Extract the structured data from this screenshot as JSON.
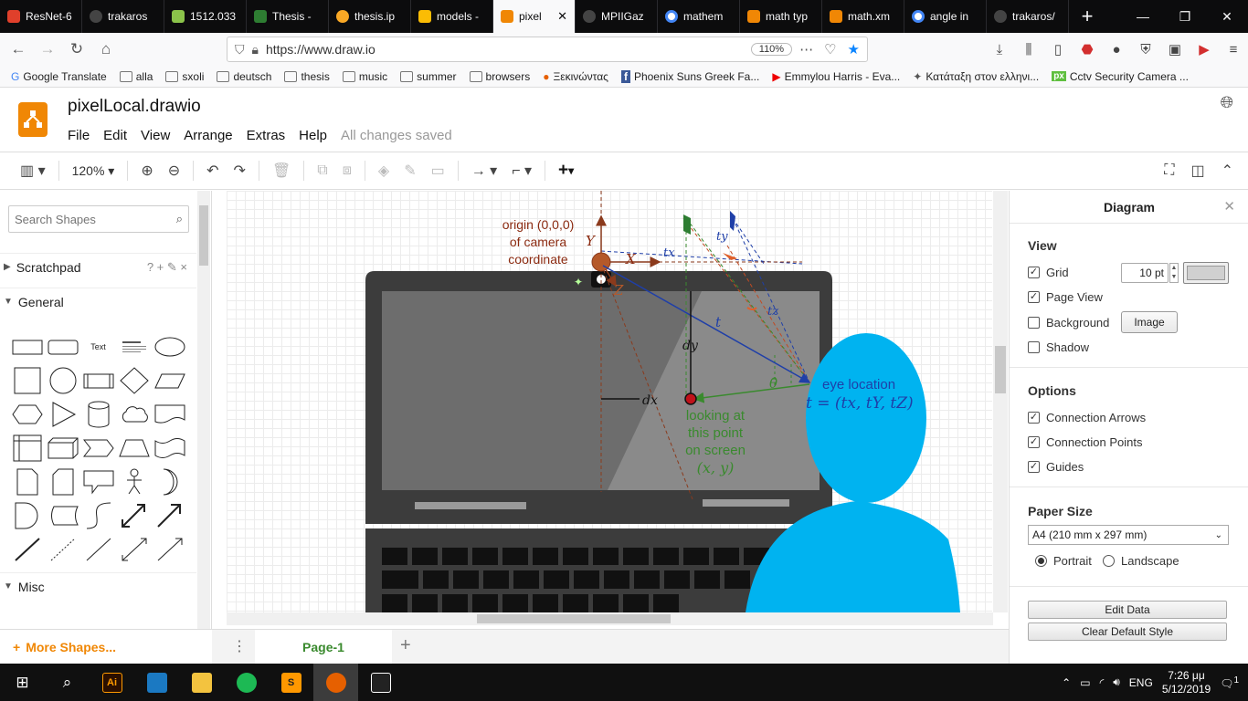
{
  "browser": {
    "tabs": [
      {
        "label": "ResNet-6",
        "color": "#e0402b",
        "active": false
      },
      {
        "label": "trakaros",
        "color": "#24292e",
        "active": false
      },
      {
        "label": "1512.033",
        "color": "#8bc34a",
        "active": false
      },
      {
        "label": "Thesis -",
        "color": "#2e7d32",
        "active": false
      },
      {
        "label": "thesis.ip",
        "color": "#f9a825",
        "active": false
      },
      {
        "label": "models -",
        "color": "#fbbc04",
        "active": false
      },
      {
        "label": "pixel",
        "color": "#f08705",
        "active": true
      },
      {
        "label": "MPIIGaz",
        "color": "#24292e",
        "active": false
      },
      {
        "label": "mathem",
        "color": "#4285f4",
        "active": false
      },
      {
        "label": "math typ",
        "color": "#f08705",
        "active": false
      },
      {
        "label": "math.xm",
        "color": "#f08705",
        "active": false
      },
      {
        "label": "angle in",
        "color": "#4285f4",
        "active": false
      },
      {
        "label": "trakaros/",
        "color": "#24292e",
        "active": false
      }
    ],
    "url": "https://www.draw.io",
    "zoom": "110%",
    "bookmarks": [
      "Google Translate",
      "alla",
      "sxoli",
      "deutsch",
      "thesis",
      "music",
      "summer",
      "browsers",
      "Ξεκινώντας",
      "Phoenix Suns Greek Fa...",
      "Emmylou Harris - Eva...",
      "Κατάταξη στον ελληνι...",
      "Cctv Security Camera ..."
    ]
  },
  "app": {
    "title": "pixelLocal.drawio",
    "menu": [
      "File",
      "Edit",
      "View",
      "Arrange",
      "Extras",
      "Help"
    ],
    "save_status": "All changes saved"
  },
  "toolbar": {
    "zoom": "120%"
  },
  "sidebar": {
    "search_placeholder": "Search Shapes",
    "scratchpad": "Scratchpad",
    "scratch_tools": "? + ✎ ×",
    "general": "General",
    "misc": "Misc",
    "more_shapes": "More Shapes..."
  },
  "diagram": {
    "origin_label_1": "origin (0,0,0)",
    "origin_label_2": "of camera",
    "origin_label_3": "coordinate",
    "axis_y": "Y",
    "axis_x": "X",
    "axis_z": "Z",
    "tx": "tx",
    "ty": "ty",
    "tz": "tz",
    "t": "t",
    "dx": "dx",
    "dy": "dy",
    "theta": "θ̂",
    "eye_label": "eye location",
    "eye_formula": "t = (tx, tY, tZ)",
    "look_1": "looking at",
    "look_2": "this point",
    "look_3": "on screen",
    "look_4": "(x, y)"
  },
  "page": {
    "tab": "Page-1"
  },
  "panel": {
    "title": "Diagram",
    "view_head": "View",
    "grid": "Grid",
    "grid_size": "10 pt",
    "page_view": "Page View",
    "background": "Background",
    "image_btn": "Image",
    "shadow": "Shadow",
    "options_head": "Options",
    "connection_arrows": "Connection Arrows",
    "connection_points": "Connection Points",
    "guides": "Guides",
    "paper_head": "Paper Size",
    "paper_value": "A4 (210 mm x 297 mm)",
    "portrait": "Portrait",
    "landscape": "Landscape",
    "edit_data": "Edit Data",
    "clear_style": "Clear Default Style"
  },
  "taskbar": {
    "lang": "ENG",
    "time": "7:26 μμ",
    "date": "5/12/2019",
    "notif": "1"
  },
  "colors": {
    "accent": "#f08705",
    "person": "#00b3f0",
    "laptop": "#3c3c3c",
    "green": "#3a8a2e"
  }
}
